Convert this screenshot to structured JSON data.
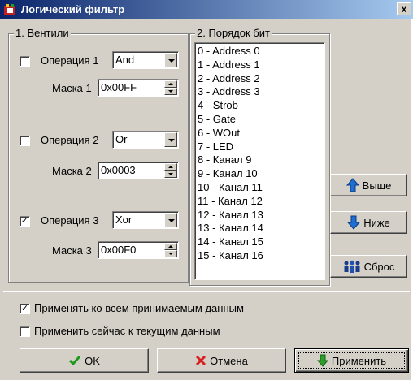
{
  "window": {
    "title": "Логический фильтр",
    "close_glyph": "x"
  },
  "gates": {
    "title": "1. Вентили",
    "ops": [
      {
        "label": "Операция 1",
        "value": "And",
        "checked": false,
        "mask_label": "Маска 1",
        "mask_value": "0x00FF"
      },
      {
        "label": "Операция 2",
        "value": "Or",
        "checked": false,
        "mask_label": "Маска 2",
        "mask_value": "0x0003"
      },
      {
        "label": "Операция 3",
        "value": "Xor",
        "checked": true,
        "mask_label": "Маска 3",
        "mask_value": "0x00F0"
      }
    ]
  },
  "bit_order": {
    "title": "2. Порядок бит",
    "items": [
      "0 - Address 0",
      "1 - Address 1",
      "2 - Address 2",
      "3 - Address 3",
      "4 - Strob",
      "5 - Gate",
      "6 - WOut",
      "7 - LED",
      "8 - Канал 9",
      "9 - Канал 10",
      "10 - Канал 11",
      "11 - Канал 12",
      "12 - Канал 13",
      "13 - Канал 14",
      "14 - Канал 15",
      "15 - Канал 16"
    ]
  },
  "side_buttons": {
    "up": "Выше",
    "down": "Ниже",
    "reset": "Сброс"
  },
  "options": {
    "apply_all": {
      "label": "Применять ко всем принимаемым данным",
      "checked": true
    },
    "apply_now": {
      "label": "Применить сейчас к текущим данным",
      "checked": false
    }
  },
  "footer": {
    "ok": "OK",
    "cancel": "Отмена",
    "apply": "Применить"
  },
  "colors": {
    "title_start": "#0a246a",
    "title_end": "#a6caf0",
    "face": "#d4d0c8",
    "ok_check": "#1c9a1c",
    "cancel_x": "#d82020",
    "arrow_blue": "#1e6fd0",
    "arrow_green": "#2aa02a"
  }
}
